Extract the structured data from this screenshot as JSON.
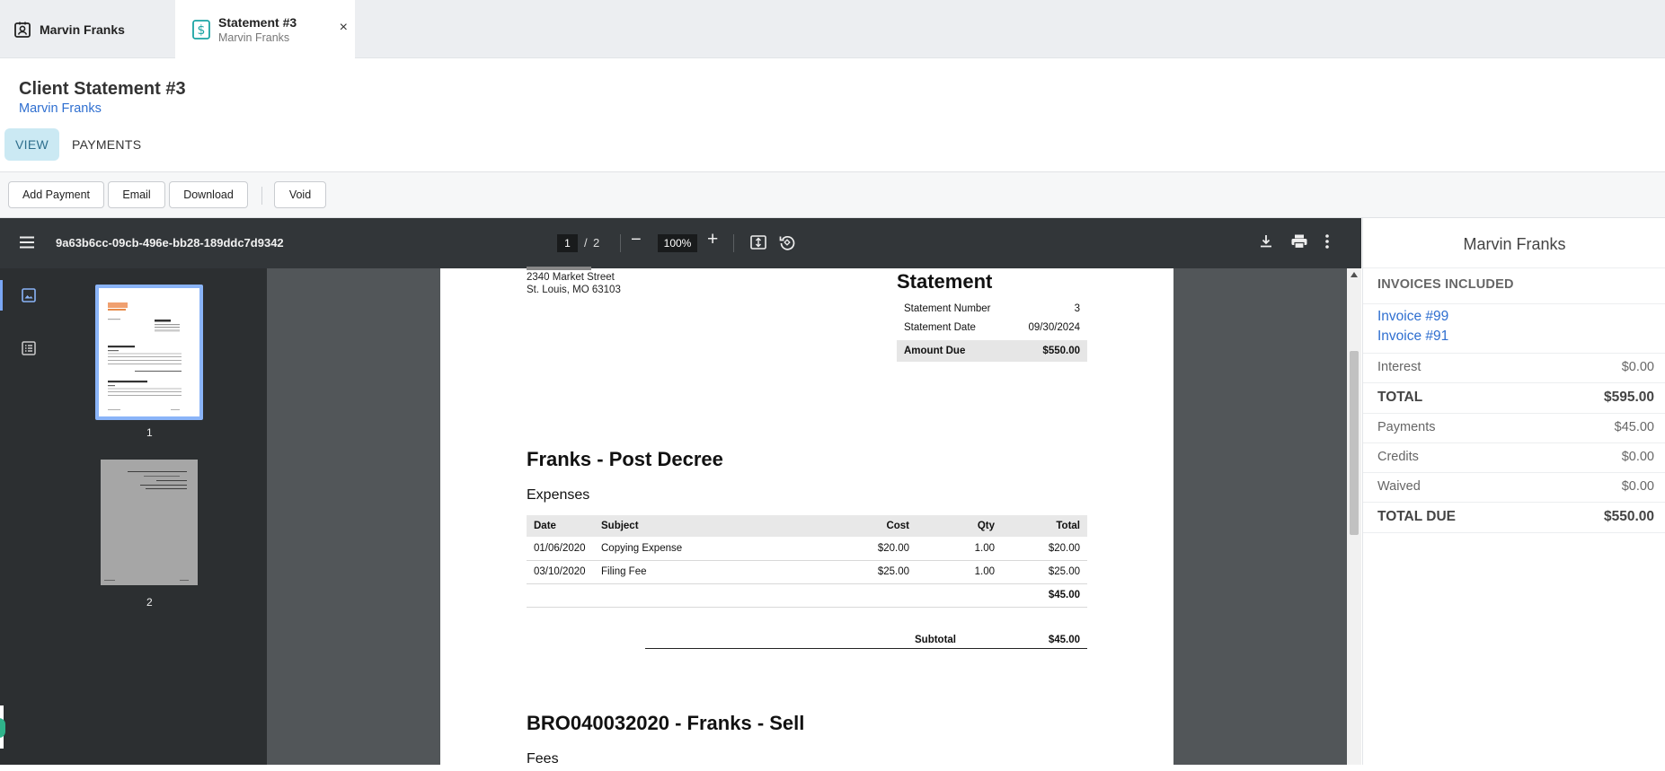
{
  "tabs": [
    {
      "title": "Marvin Franks",
      "icon": "contact-card-icon"
    },
    {
      "title": "Statement #3",
      "subtitle": "Marvin Franks",
      "icon": "dollar-document-icon",
      "close": "×"
    }
  ],
  "header": {
    "title": "Client Statement #3",
    "client": "Marvin Franks"
  },
  "subtabs": {
    "view": "VIEW",
    "payments": "PAYMENTS"
  },
  "toolbar": {
    "add_payment": "Add Payment",
    "email": "Email",
    "download": "Download",
    "void": "Void"
  },
  "viewer": {
    "file_id": "9a63b6cc-09cb-496e-bb28-189ddc7d9342",
    "page_current": "1",
    "page_sep": "/",
    "page_total": "2",
    "zoom": "100%",
    "thumbs": [
      "1",
      "2"
    ]
  },
  "document": {
    "address_line1": "2340 Market Street",
    "address_line2": "St. Louis, MO 63103",
    "statement_title": "Statement",
    "statement_number_label": "Statement Number",
    "statement_number": "3",
    "statement_date_label": "Statement Date",
    "statement_date": "09/30/2024",
    "amount_due_label": "Amount Due",
    "amount_due": "$550.00",
    "matter1_title": "Franks - Post Decree",
    "expenses_title": "Expenses",
    "table_headers": {
      "date": "Date",
      "subject": "Subject",
      "cost": "Cost",
      "qty": "Qty",
      "total": "Total"
    },
    "rows": [
      {
        "date": "01/06/2020",
        "subject": "Copying Expense",
        "cost": "$20.00",
        "qty": "1.00",
        "total": "$20.00"
      },
      {
        "date": "03/10/2020",
        "subject": "Filing Fee",
        "cost": "$25.00",
        "qty": "1.00",
        "total": "$25.00"
      }
    ],
    "expenses_total": "$45.00",
    "subtotal_label": "Subtotal",
    "subtotal_value": "$45.00",
    "matter2_title": "BRO040032020 - Franks - Sell",
    "fees_title": "Fees"
  },
  "panel": {
    "name": "Marvin Franks",
    "invoices_heading": "INVOICES INCLUDED",
    "invoices": [
      "Invoice #99",
      "Invoice #91"
    ],
    "interest_label": "Interest",
    "interest": "$0.00",
    "total_label": "TOTAL",
    "total": "$595.00",
    "payments_label": "Payments",
    "payments": "$45.00",
    "credits_label": "Credits",
    "credits": "$0.00",
    "waived_label": "Waived",
    "waived": "$0.00",
    "total_due_label": "TOTAL DUE",
    "total_due": "$550.00"
  }
}
